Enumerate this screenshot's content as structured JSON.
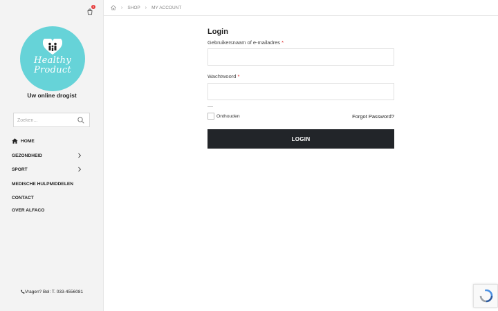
{
  "cart": {
    "badge": "0"
  },
  "logo": {
    "line1": "Healthy",
    "line2": "Product"
  },
  "tagline": "Uw online drogist",
  "search": {
    "placeholder": "Zoeken..."
  },
  "nav": {
    "items": [
      {
        "label": "Home",
        "icon": "home-icon"
      },
      {
        "label": "Gezondheid",
        "has_children": true
      },
      {
        "label": "Sport",
        "has_children": true
      },
      {
        "label": "Medische hulpmiddelen"
      },
      {
        "label": "Contact"
      },
      {
        "label": "Over Alfaco"
      }
    ]
  },
  "phone": "Vragen? Bel: T. 033-4556081",
  "breadcrumb": {
    "items": [
      "Shop",
      "My Account"
    ]
  },
  "form": {
    "title": "Login",
    "username_label": "Gebruikersnaam of e-mailadres",
    "password_label": "Wachtwoord",
    "required_mark": "*",
    "remember_label": "Onthouden",
    "forgot_label": "Forgot Password?",
    "login_button": "Login"
  },
  "colors": {
    "accent_teal": "#66d3d8",
    "button_dark": "#222529",
    "required_red": "#dd2222",
    "badge_red": "#e63b3b"
  }
}
